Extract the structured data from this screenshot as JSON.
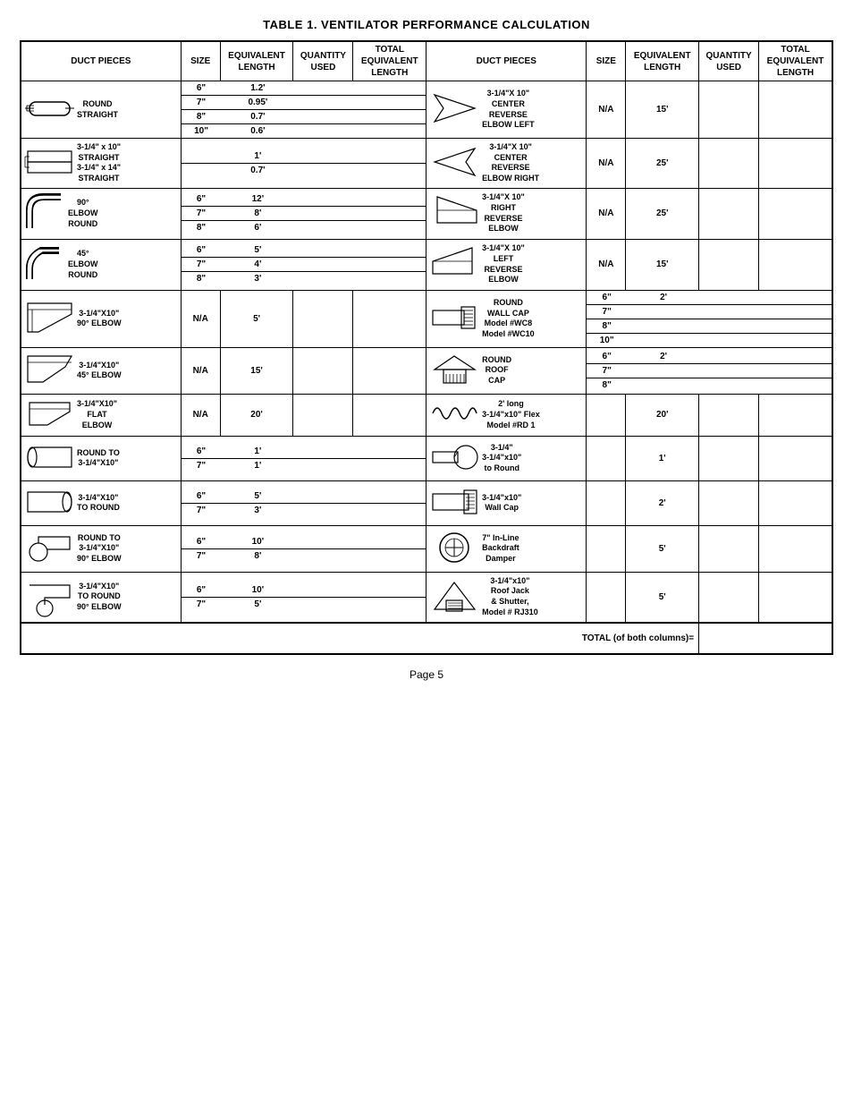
{
  "title": "TABLE 1.  VENTILATOR PERFORMANCE CALCULATION",
  "headers": {
    "duct_pieces": "DUCT PIECES",
    "size": "SIZE",
    "eq_length": "EQUIVALENT LENGTH",
    "qty_used": "QUANTITY USED",
    "total_eq_length": "TOTAL EQUIVALENT LENGTH"
  },
  "left_rows": [
    {
      "label": "ROUND\nSTRAIGHT",
      "sizes": [
        "6\"",
        "7\"",
        "8\"",
        "10\""
      ],
      "values": [
        "1.2'",
        "0.95'",
        "0.7'",
        "0.6'"
      ]
    },
    {
      "label": "3-1/4\" x 10\"\nSTRAIGHT\n3-1/4\" x 14\"\nSTRAIGHT",
      "sizes": [
        "",
        ""
      ],
      "values": [
        "1'",
        "0.7'"
      ]
    },
    {
      "label": "90°\nELBOW\nROUND",
      "sizes": [
        "6\"",
        "7\"",
        "8\""
      ],
      "values": [
        "12'",
        "8'",
        "6'"
      ]
    },
    {
      "label": "45°\nELBOW\nROUND",
      "sizes": [
        "6\"",
        "7\"",
        "8\""
      ],
      "values": [
        "5'",
        "4'",
        "3'"
      ]
    },
    {
      "label": "3-1/4\"X10\"\n90° ELBOW",
      "sizes": [
        "N/A"
      ],
      "values": [
        "5'"
      ]
    },
    {
      "label": "3-1/4\"X10\"\n45° ELBOW",
      "sizes": [
        "N/A"
      ],
      "values": [
        "15'"
      ]
    },
    {
      "label": "3-1/4\"X10\"\nFLAT\nELBOW",
      "sizes": [
        "N/A"
      ],
      "values": [
        "20'"
      ]
    },
    {
      "label": "ROUND TO\n3-1/4\"X10\"",
      "sizes": [
        "6\"",
        "7\""
      ],
      "values": [
        "1'",
        "1'"
      ]
    },
    {
      "label": "3-1/4\"X10\"\nTO ROUND",
      "sizes": [
        "6\"",
        "7\""
      ],
      "values": [
        "5'",
        "3'"
      ]
    },
    {
      "label": "ROUND TO\n3-1/4\"X10\"\n90° ELBOW",
      "sizes": [
        "6\"",
        "7\""
      ],
      "values": [
        "10'",
        "8'"
      ]
    },
    {
      "label": "3-1/4\"X10\"\nTO ROUND\n90° ELBOW",
      "sizes": [
        "6\"",
        "7\""
      ],
      "values": [
        "10'",
        "5'"
      ]
    }
  ],
  "right_rows": [
    {
      "label": "3-1/4\"X 10\"\nCENTER\nREVERSE\nELBOW LEFT",
      "sizes": [
        "N/A"
      ],
      "values": [
        "15'"
      ]
    },
    {
      "label": "3-1/4\"X 10\"\nCENTER\nREVERSE\nELBOW RIGHT",
      "sizes": [
        "N/A"
      ],
      "values": [
        "25'"
      ]
    },
    {
      "label": "3-1/4\"X 10\"\nRIGHT\nREVERSE\nELBOW",
      "sizes": [
        "N/A"
      ],
      "values": [
        "25'"
      ]
    },
    {
      "label": "3-1/4\"X 10\"\nLEFT\nREVERSE\nELBOW",
      "sizes": [
        "N/A"
      ],
      "values": [
        "15'"
      ]
    },
    {
      "label": "ROUND\nWALL CAP\nModel #WC8\nModel #WC10",
      "sizes": [
        "6\"",
        "7\"",
        "8\"",
        "10\""
      ],
      "values": [
        "2'",
        "",
        "",
        ""
      ]
    },
    {
      "label": "ROUND\nROOF\nCAP",
      "sizes": [
        "6\"",
        "7\"",
        "8\""
      ],
      "values": [
        "2'",
        "",
        ""
      ]
    },
    {
      "label": "2' long\n3-1/4\"x10\" Flex\nModel #RD 1",
      "sizes": [
        ""
      ],
      "values": [
        "20'"
      ]
    },
    {
      "label": "3-1/4\"\n3-1/4\"x10\"\nto Round",
      "sizes": [
        ""
      ],
      "values": [
        "1'"
      ]
    },
    {
      "label": "3-1/4\"x10\"\nWall Cap",
      "sizes": [
        ""
      ],
      "values": [
        "2'"
      ]
    },
    {
      "label": "7\" In-Line\nBackdraft\nDamper",
      "sizes": [
        ""
      ],
      "values": [
        "5'"
      ]
    },
    {
      "label": "3-1/4\"x10\"\nRoof Jack\n& Shutter,\nModel # RJ310",
      "sizes": [
        ""
      ],
      "values": [
        "5'"
      ]
    }
  ],
  "total_label": "TOTAL (of both columns)=",
  "page_number": "Page 5"
}
